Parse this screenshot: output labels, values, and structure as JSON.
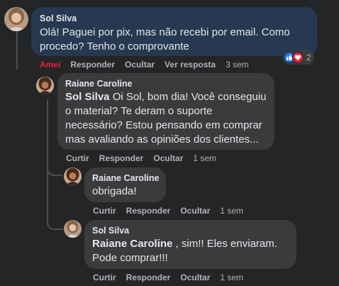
{
  "comment": {
    "author": "Sol Silva",
    "text": "Olá! Paguei por pix, mas não recebi por email. Como procedo? Tenho o comprovante",
    "actions": {
      "like": "Amei",
      "reply": "Responder",
      "hide": "Ocultar",
      "view_replies": "Ver resposta",
      "time": "3 sem"
    },
    "reactions": {
      "icons": [
        "like-icon",
        "love-icon"
      ],
      "count": "2"
    }
  },
  "replies": [
    {
      "author": "Raiane Caroline",
      "mention": "Sol Silva",
      "text": " Oi Sol, bom dia! Você conseguiu o material? Te deram o suporte necessário? Estou pensando em comprar mas avaliando as opiniões dos clientes...",
      "actions": {
        "like": "Curtir",
        "reply": "Responder",
        "hide": "Ocultar",
        "time": "1 sem"
      }
    },
    {
      "author": "Raiane Caroline",
      "mention": "",
      "text": "obrigada!",
      "actions": {
        "like": "Curtir",
        "reply": "Responder",
        "hide": "Ocultar",
        "time": "1 sem"
      }
    },
    {
      "author": "Sol Silva",
      "mention": "Raiane Caroline",
      "text": " , sim!! Eles enviaram. Pode comprar!!!",
      "actions": {
        "like": "Curtir",
        "reply": "Responder",
        "hide": "Ocultar",
        "time": "1 sem"
      }
    }
  ],
  "colors": {
    "background": "#242526",
    "highlight_bubble": "#263951",
    "bubble": "#3a3b3c",
    "text": "#e4e6eb",
    "secondary_text": "#b0b3b8",
    "love": "#e4233d",
    "like": "#1877f2"
  }
}
